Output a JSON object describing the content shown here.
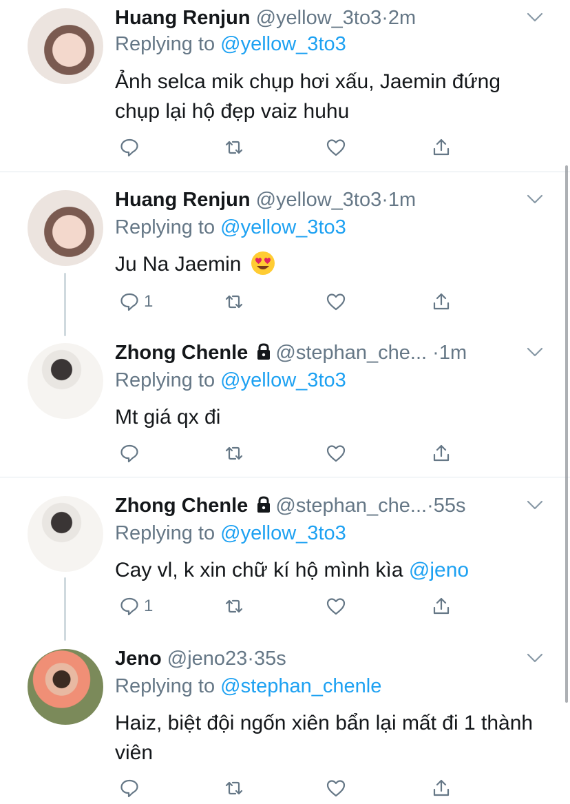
{
  "tweets": [
    {
      "name": "Huang Renjun",
      "handle": "@yellow_3to3",
      "dot": "·",
      "time": "2m",
      "replying_label": "Replying to",
      "replying_to": "@yellow_3to3",
      "text": "Ảnh selca mik chụp hơi xấu, Jaemin đứng chụp lại hộ đẹp vaiz huhu",
      "reply_count": ""
    },
    {
      "name": "Huang Renjun",
      "handle": "@yellow_3to3",
      "dot": "·",
      "time": "1m",
      "replying_label": "Replying to",
      "replying_to": "@yellow_3to3",
      "text": "Ju Na Jaemin",
      "emoji": "heart-eyes-emoji",
      "reply_count": "1"
    },
    {
      "name": "Zhong Chenle",
      "handle": "@stephan_che...",
      "dot": "·",
      "time": "1m",
      "replying_label": "Replying to",
      "replying_to": "@yellow_3to3",
      "text": "Mt giá qx đi",
      "reply_count": ""
    },
    {
      "name": "Zhong Chenle",
      "handle": "@stephan_che...",
      "dot": "·",
      "time": "55s",
      "replying_label": "Replying to",
      "replying_to": "@yellow_3to3",
      "text": "Cay vl, k xin chữ kí hộ mình kìa",
      "text_mention": "@jeno",
      "reply_count": "1"
    },
    {
      "name": "Jeno",
      "handle": "@jeno23",
      "dot": "·",
      "time": "35s",
      "replying_label": "Replying to",
      "replying_to": "@stephan_chenle",
      "text": "Haiz, biệt đội ngốn xiên bẩn lại mất đi 1 thành viên",
      "reply_count": ""
    }
  ],
  "colors": {
    "link": "#1da1f2",
    "muted": "#657786",
    "text": "#14171a",
    "divider": "#e1e8ed"
  }
}
